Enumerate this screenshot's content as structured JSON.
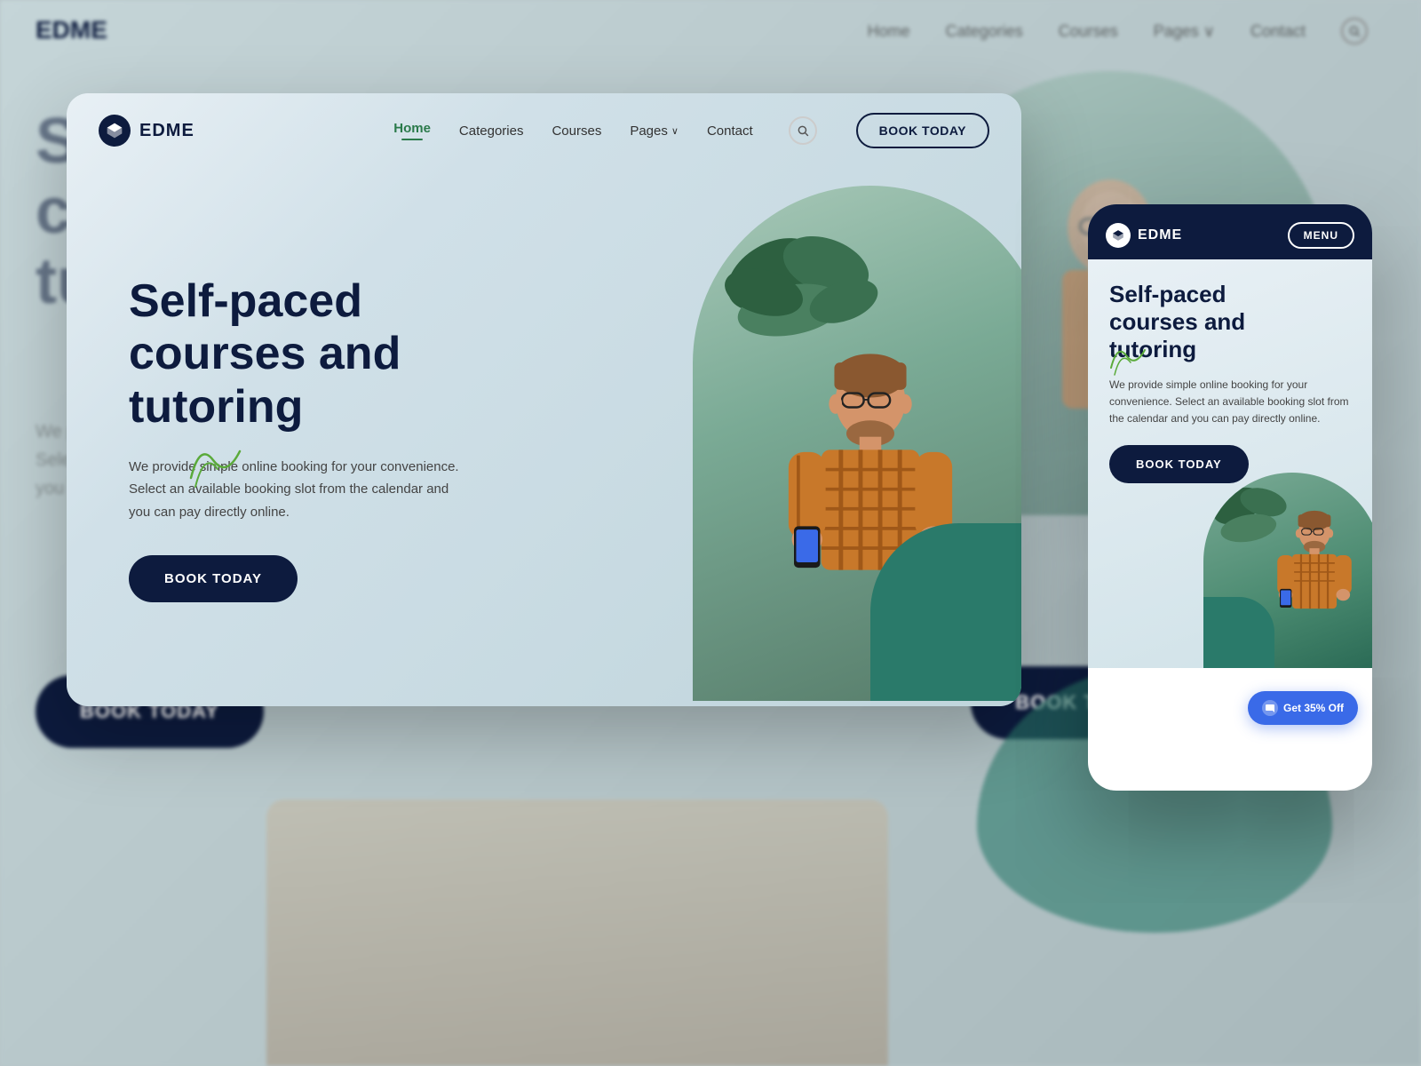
{
  "brand": {
    "name": "EDME",
    "icon_alt": "diamond-icon"
  },
  "nav": {
    "home": "Home",
    "categories": "Categories",
    "courses": "Courses",
    "pages": "Pages",
    "contact": "Contact",
    "book_btn": "BOOK TODAY",
    "search_placeholder": "Search"
  },
  "hero": {
    "title_line1": "Self-paced",
    "title_line2": "courses and",
    "title_line3": "tutoring",
    "description": "We provide simple online booking for your convenience. Select an available booking slot from the calendar and you can pay directly online.",
    "book_btn": "BOOK TODAY"
  },
  "mobile": {
    "menu_btn": "MENU",
    "hero_title_line1": "Self-paced",
    "hero_title_line2": "courses and",
    "hero_title_line3": "tutoring",
    "description": "We provide simple online booking for your convenience. Select an available booking slot from the calendar and you can pay directly online.",
    "book_btn": "BOOK TODAY",
    "discount_badge": "Get 35% Off"
  },
  "colors": {
    "primary_dark": "#0d1b3e",
    "accent_green": "#2a7a4a",
    "teal": "#2a7a6a",
    "blue_badge": "#3a6ae8",
    "bg_gradient_start": "#e8f0f5",
    "bg_gradient_end": "#c0d5dc"
  }
}
